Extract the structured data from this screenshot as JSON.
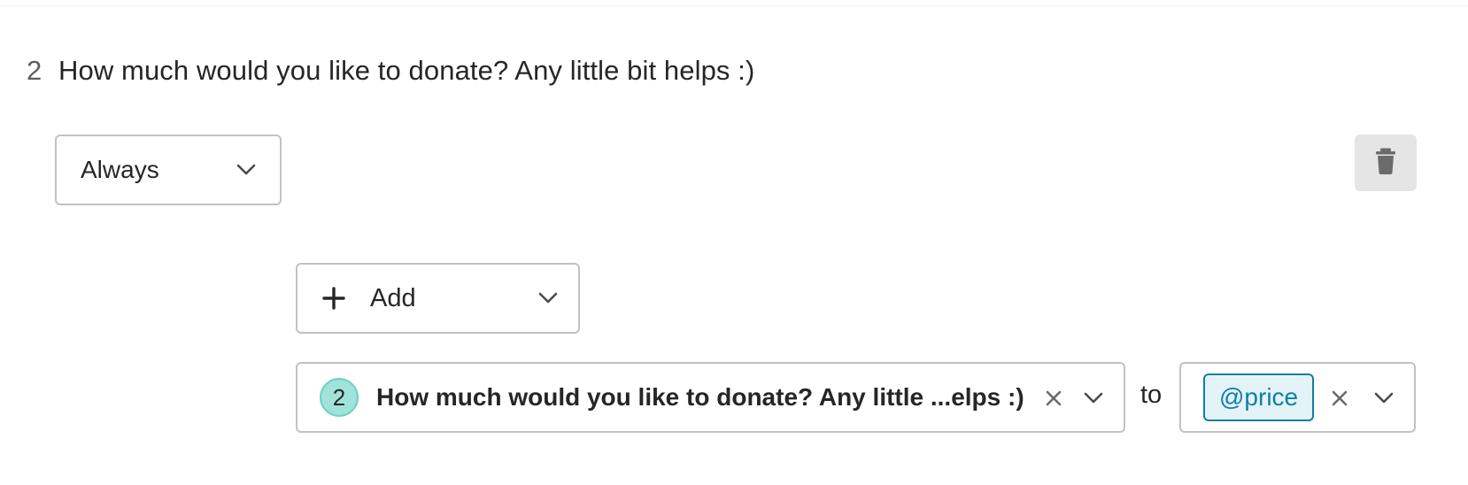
{
  "question": {
    "number": "2",
    "title": "How much would you like to donate? Any little bit helps :)"
  },
  "condition": {
    "selected": "Always"
  },
  "actions": {
    "add_label": "Add"
  },
  "calculation": {
    "question_badge": "2",
    "question_value": "How much would you like to donate? Any little ...elps :)",
    "connector": "to",
    "variable": "@price"
  },
  "icons": {
    "delete": "trash-icon",
    "add": "plus-icon",
    "clear": "close-icon",
    "expand": "chevron-down-icon"
  },
  "colors": {
    "badge_fill": "#9fe3da",
    "variable_accent": "#0f7fa6",
    "variable_fill": "#e4f3f8",
    "delete_fill": "#e5e5e5"
  }
}
